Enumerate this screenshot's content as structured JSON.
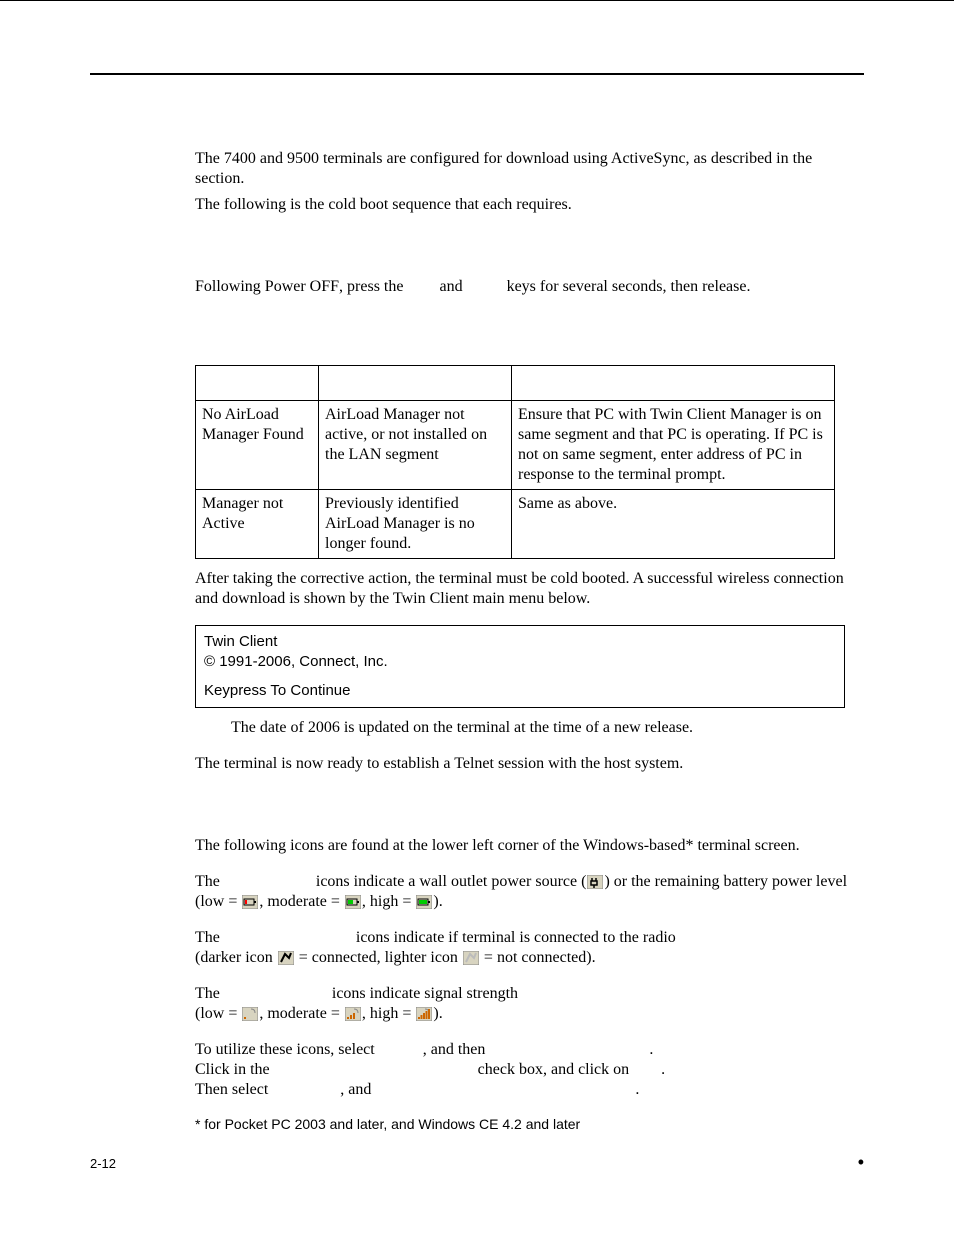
{
  "intro": {
    "p1a": "The 7400 and 9500 terminals are configured for download using ActiveSync, as described in the ",
    "p1b": " section.",
    "p2": "The following is the cold boot sequence that each requires."
  },
  "boot": {
    "a": "Following Power ",
    "off": "OFF",
    "b": ", press the ",
    "c": " and ",
    "d": " keys for several seconds, then release."
  },
  "table": {
    "rows": [
      {
        "msg": "No AirLoad Manager Found",
        "cause": "AirLoad Manager not active, or not installed on the LAN segment",
        "action": "Ensure that PC with Twin Client Manager is on same segment and that PC is operating. If PC is not on same segment, enter address of PC in response to the terminal prompt."
      },
      {
        "msg": "Manager not Active",
        "cause": "Previously identified AirLoad Manager is no longer found.",
        "action": "Same as above."
      }
    ]
  },
  "after": "After taking the corrective action, the terminal must be cold booted.  A successful wireless connection and download is shown by the Twin Client main menu below.",
  "terminal": {
    "l1": "Twin Client",
    "l2": "© 1991-2006, Connect, Inc.",
    "l3": "Keypress To Continue"
  },
  "note": "The date of 2006 is updated on the terminal at the time of a new release.",
  "ready": "The terminal is now ready to establish a Telnet session with the host system.",
  "icons_intro": "The following icons are found at the lower left corner of the Windows-based* terminal screen.",
  "power": {
    "a": "The ",
    "b": " icons indicate a wall outlet power source (",
    "c": ") or the remaining battery power level (low = ",
    "d": ", moderate = ",
    "e": ", high = ",
    "f": ")."
  },
  "radio": {
    "a": "The ",
    "b": " icons indicate if terminal is connected to the radio",
    "c": "(darker icon ",
    "d": " = connected, lighter icon ",
    "e": " = not connected)."
  },
  "signal": {
    "a": "The ",
    "b": " icons indicate signal strength",
    "c": "(low = ",
    "d": ", moderate = ",
    "e": ", high = ",
    "f": ")."
  },
  "utilize": {
    "a": "To utilize these icons, select ",
    "b": ", and then ",
    "c": ".",
    "d": "Click in the ",
    "e": " check box, and click on ",
    "f": ".",
    "g": "Then select ",
    "h": ", and ",
    "i": "."
  },
  "footnote": "* for Pocket PC 2003 and later, and Windows CE 4.2 and later",
  "footer": {
    "page": "2-12",
    "dot": "•"
  }
}
